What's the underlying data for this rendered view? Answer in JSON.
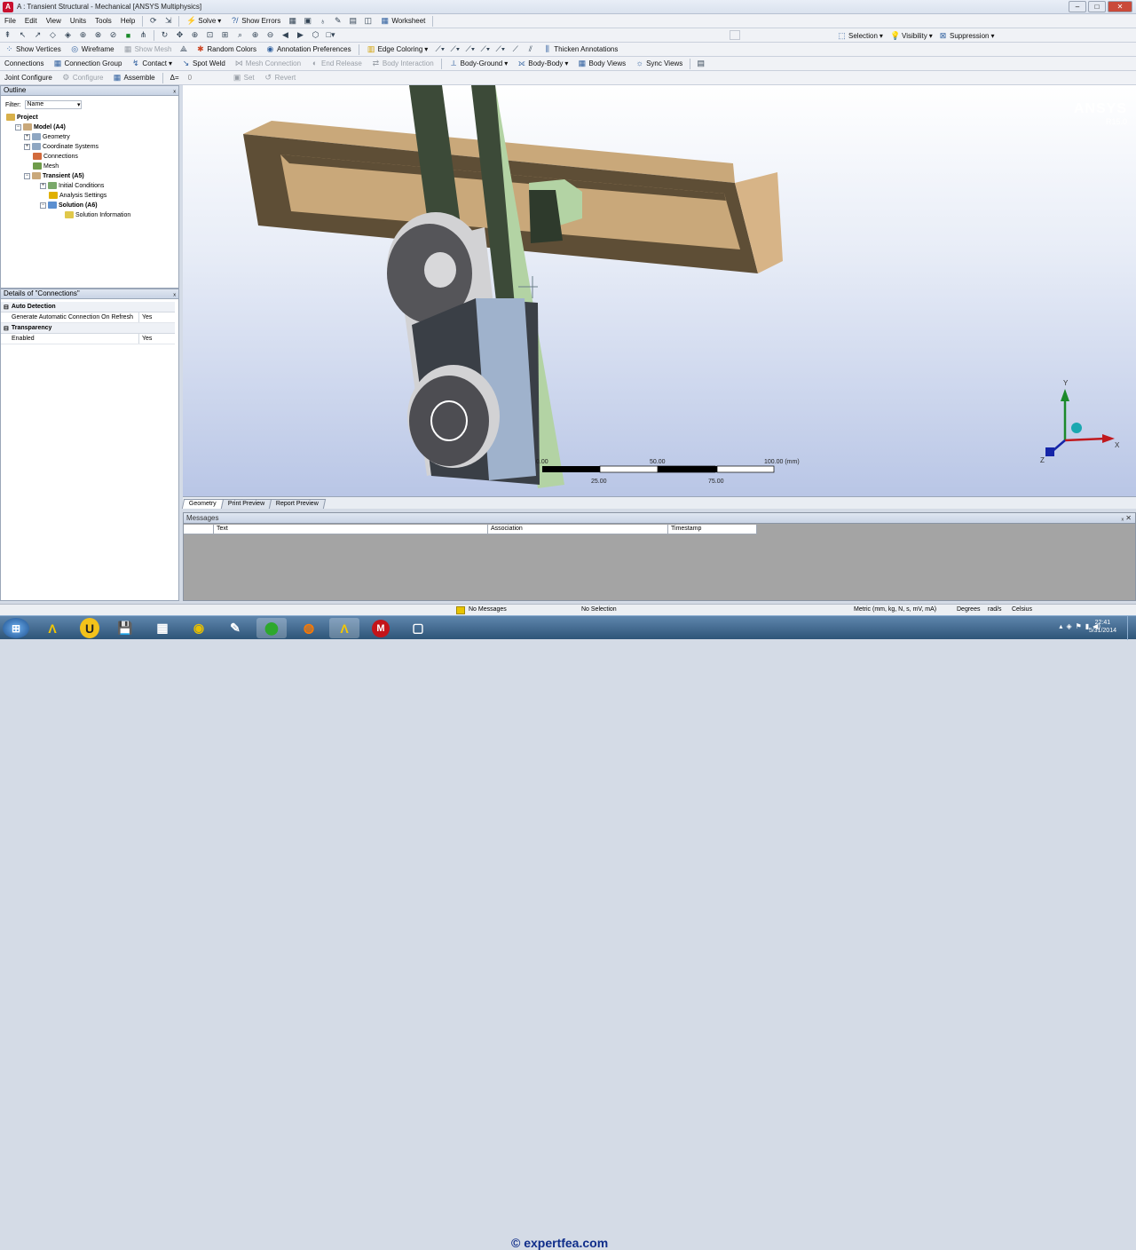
{
  "window": {
    "title": "A : Transient Structural - Mechanical [ANSYS Multiphysics]"
  },
  "menu": {
    "items": [
      "File",
      "Edit",
      "View",
      "Units",
      "Tools",
      "Help"
    ],
    "solve": "Solve",
    "show_errors": "Show Errors",
    "worksheet": "Worksheet"
  },
  "right_toolbar": {
    "selection": "Selection",
    "visibility": "Visibility",
    "suppression": "Suppression"
  },
  "toolbar_display": {
    "show_vertices": "Show Vertices",
    "wireframe": "Wireframe",
    "show_mesh": "Show Mesh",
    "random_colors": "Random Colors",
    "annotation_preferences": "Annotation Preferences",
    "edge_coloring": "Edge Coloring",
    "thicken_annotations": "Thicken Annotations"
  },
  "toolbar_connections": {
    "connections": "Connections",
    "connection_group": "Connection Group",
    "contact": "Contact",
    "spot_weld": "Spot Weld",
    "mesh_connection": "Mesh Connection",
    "end_release": "End Release",
    "body_interaction": "Body Interaction",
    "body_ground": "Body-Ground",
    "body_body": "Body-Body",
    "body_views": "Body Views",
    "sync_views": "Sync Views"
  },
  "toolbar_joint": {
    "joint_configure": "Joint Configure",
    "configure": "Configure",
    "assemble": "Assemble",
    "delta": "Δ=",
    "delta_value": "0",
    "set": "Set",
    "revert": "Revert"
  },
  "outline": {
    "title": "Outline",
    "filter_label": "Filter:",
    "filter_value": "Name",
    "tree": [
      {
        "label": "Project",
        "bold": true
      },
      {
        "label": "Model (A4)",
        "bold": true
      },
      {
        "label": "Geometry",
        "bold": false
      },
      {
        "label": "Coordinate Systems",
        "bold": false
      },
      {
        "label": "Connections",
        "bold": false
      },
      {
        "label": "Mesh",
        "bold": false
      },
      {
        "label": "Transient (A5)",
        "bold": true
      },
      {
        "label": "Initial Conditions",
        "bold": false
      },
      {
        "label": "Analysis Settings",
        "bold": false
      },
      {
        "label": "Solution (A6)",
        "bold": true
      },
      {
        "label": "Solution Information",
        "bold": false
      }
    ]
  },
  "details": {
    "title": "Details of \"Connections\"",
    "groups": [
      {
        "name": "Auto Detection",
        "rows": [
          {
            "key": "Generate Automatic Connection On Refresh",
            "value": "Yes"
          }
        ]
      },
      {
        "name": "Transparency",
        "rows": [
          {
            "key": "Enabled",
            "value": "Yes"
          }
        ]
      }
    ]
  },
  "viewport": {
    "brand": "ANSYS",
    "version": "R15.0",
    "scale_labels_top": [
      "0.00",
      "50.00",
      "100.00 (mm)"
    ],
    "scale_labels_bottom": [
      "25.00",
      "75.00"
    ],
    "colors": {
      "frame": "#c9a87a",
      "frame_dark": "#5e4e36",
      "rod": "#b3d3a4",
      "rod_dark": "#3c4a38",
      "link": "#d2d2d4",
      "block": "#9fb2cc"
    }
  },
  "view_tabs": [
    "Geometry",
    "Print Preview",
    "Report Preview"
  ],
  "messages": {
    "title": "Messages",
    "columns": [
      "Text",
      "Association",
      "Timestamp"
    ]
  },
  "status": {
    "messages": "No Messages",
    "selection": "No Selection",
    "units": "Metric (mm, kg, N, s, mV, mA)",
    "angle": "Degrees",
    "rate": "rad/s",
    "temp": "Celsius"
  },
  "taskbar": {
    "watermark": "© expertfea.com",
    "time": "22:41",
    "date": "5/31/2014"
  }
}
